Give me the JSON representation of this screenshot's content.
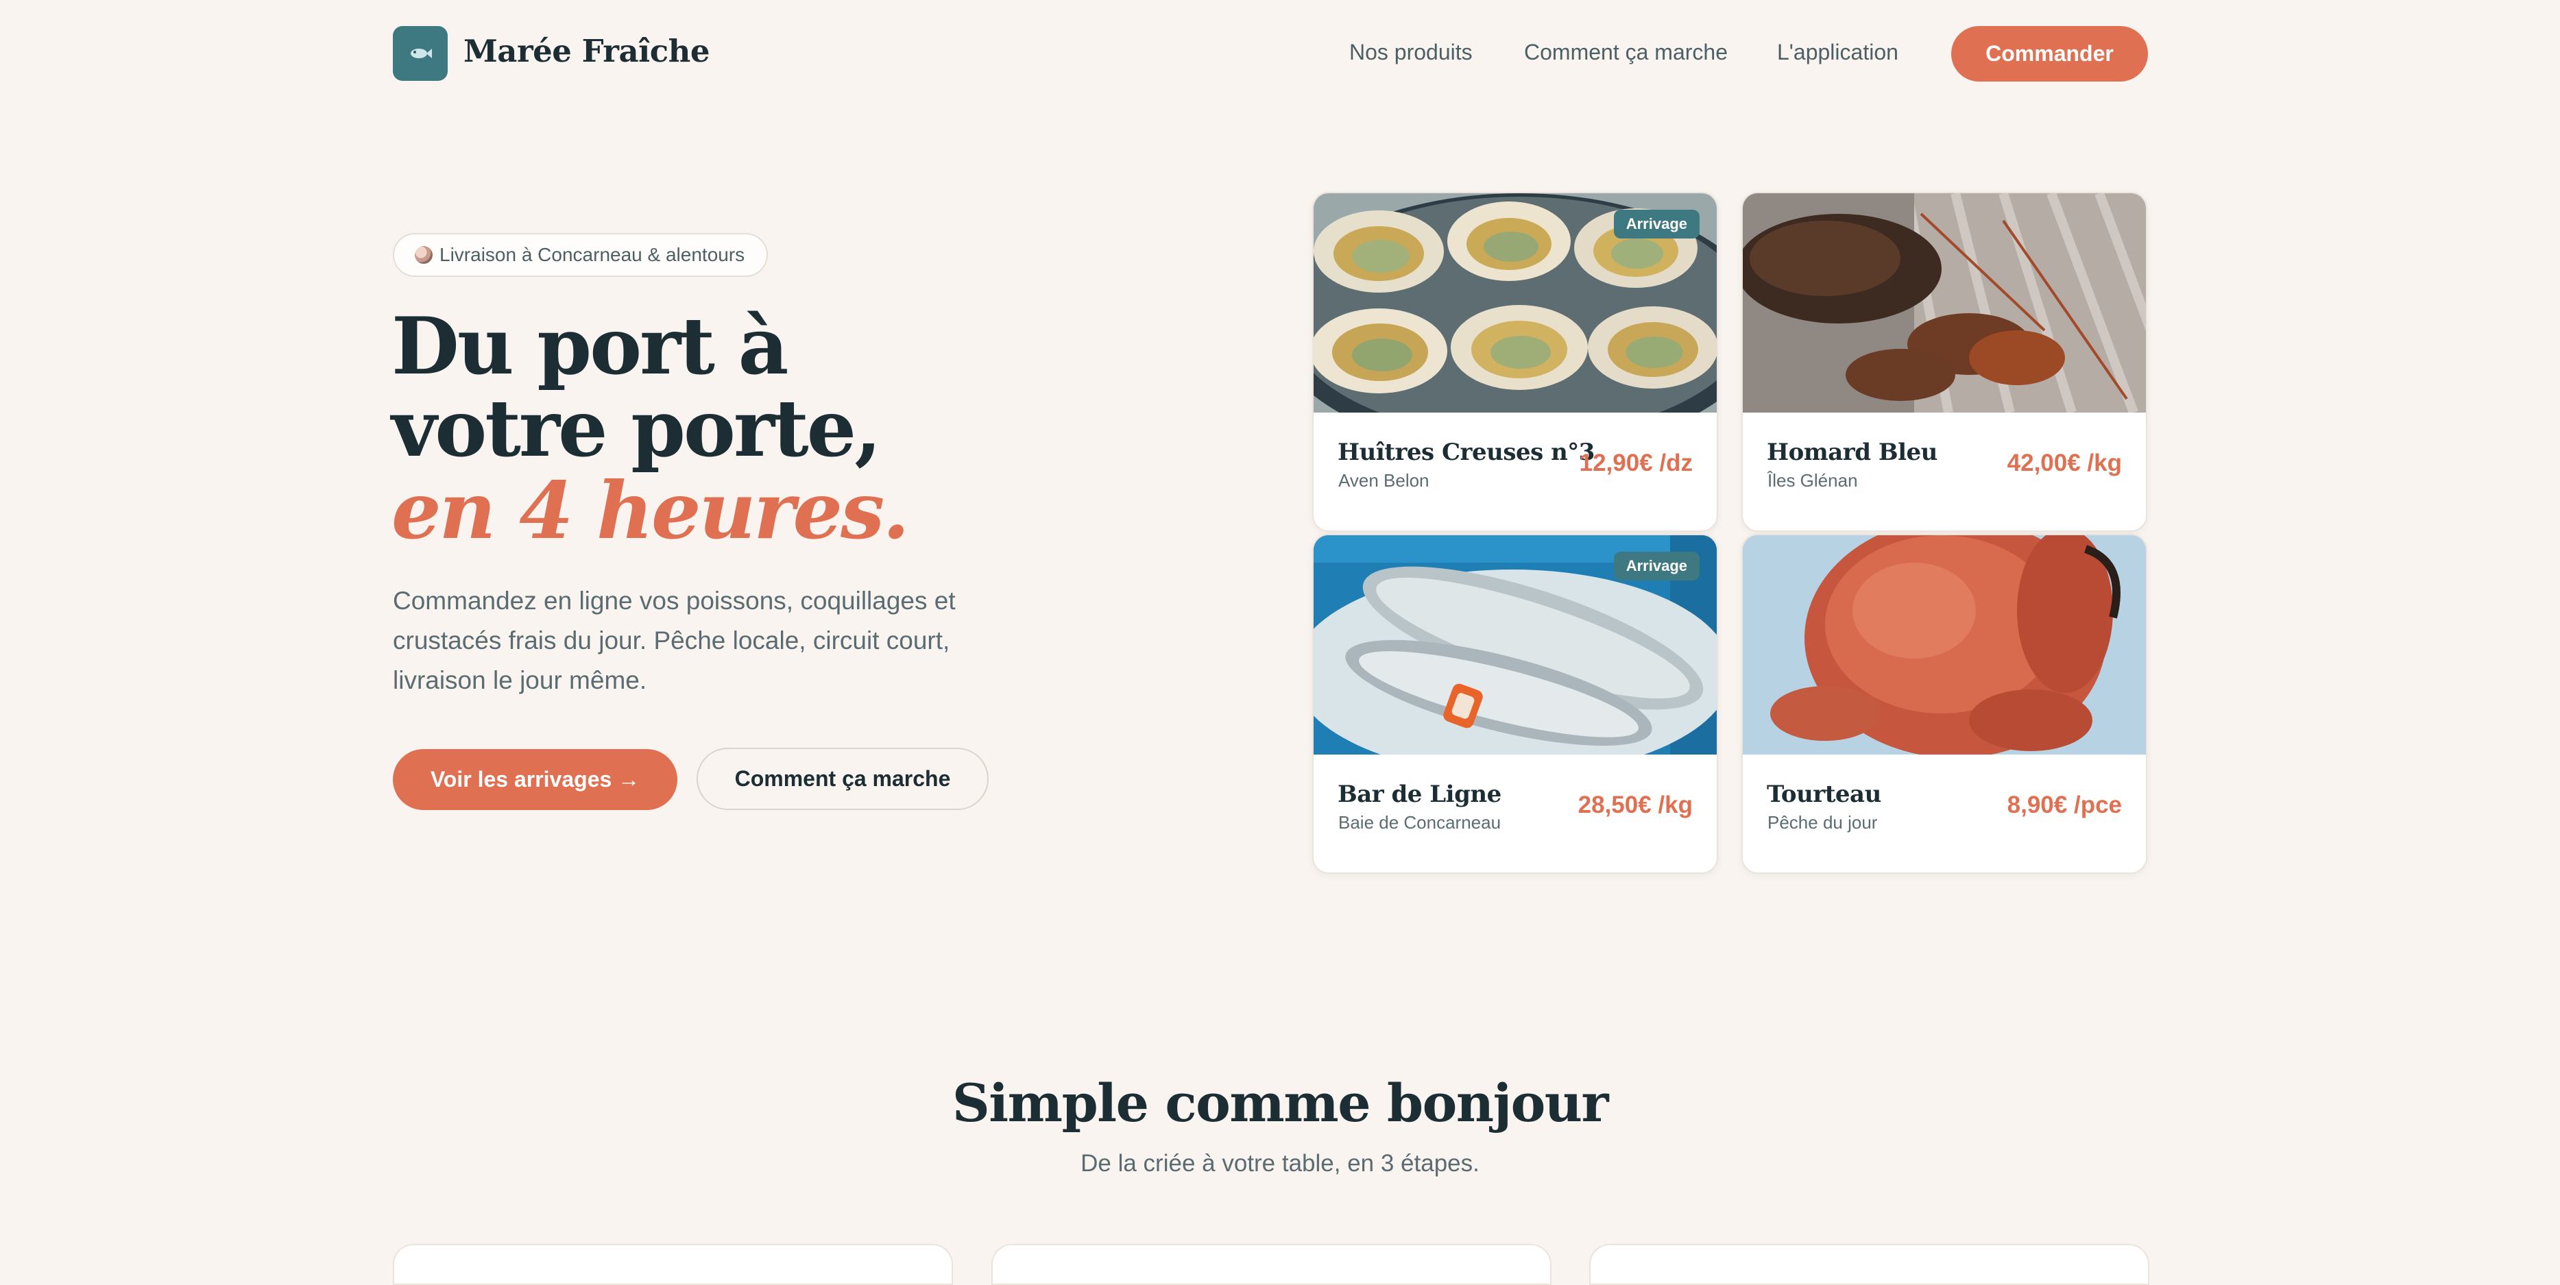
{
  "brand": {
    "name": "Marée Fraîche",
    "logo_icon": "fish-icon"
  },
  "nav": {
    "links": [
      "Nos produits",
      "Comment ça marche",
      "L'application"
    ],
    "cta": "Commander"
  },
  "hero": {
    "pill": "Livraison à Concarneau & alentours",
    "pill_icon": "shell-icon",
    "title_line1": "Du port à",
    "title_line2": "votre porte,",
    "title_accent": "en 4 heures.",
    "lead": "Commandez en ligne vos poissons, coquillages et crustacés frais du jour. Pêche locale, circuit court, livraison le jour même.",
    "primary_button": "Voir les arrivages →",
    "secondary_button": "Comment ça marche"
  },
  "products": [
    {
      "name": "Huîtres Creuses n°3",
      "origin": "Aven Belon",
      "price": "12,90€ /dz",
      "badge": "Arrivage",
      "image": "oysters-photo"
    },
    {
      "name": "Homard Bleu",
      "origin": "Îles Glénan",
      "price": "42,00€ /kg",
      "badge": "",
      "image": "lobster-photo"
    },
    {
      "name": "Bar de Ligne",
      "origin": "Baie de Concarneau",
      "price": "28,50€ /kg",
      "badge": "Arrivage",
      "image": "sea-bass-photo"
    },
    {
      "name": "Tourteau",
      "origin": "Pêche du jour",
      "price": "8,90€ /pce",
      "badge": "",
      "image": "crab-photo"
    }
  ],
  "how_it_works": {
    "title": "Simple comme bonjour",
    "subtitle": "De la criée à votre table, en 3 étapes."
  },
  "colors": {
    "accent": "#e07052",
    "brand_teal": "#3e7880",
    "background": "#f9f4ef",
    "ink": "#1c2d33"
  }
}
